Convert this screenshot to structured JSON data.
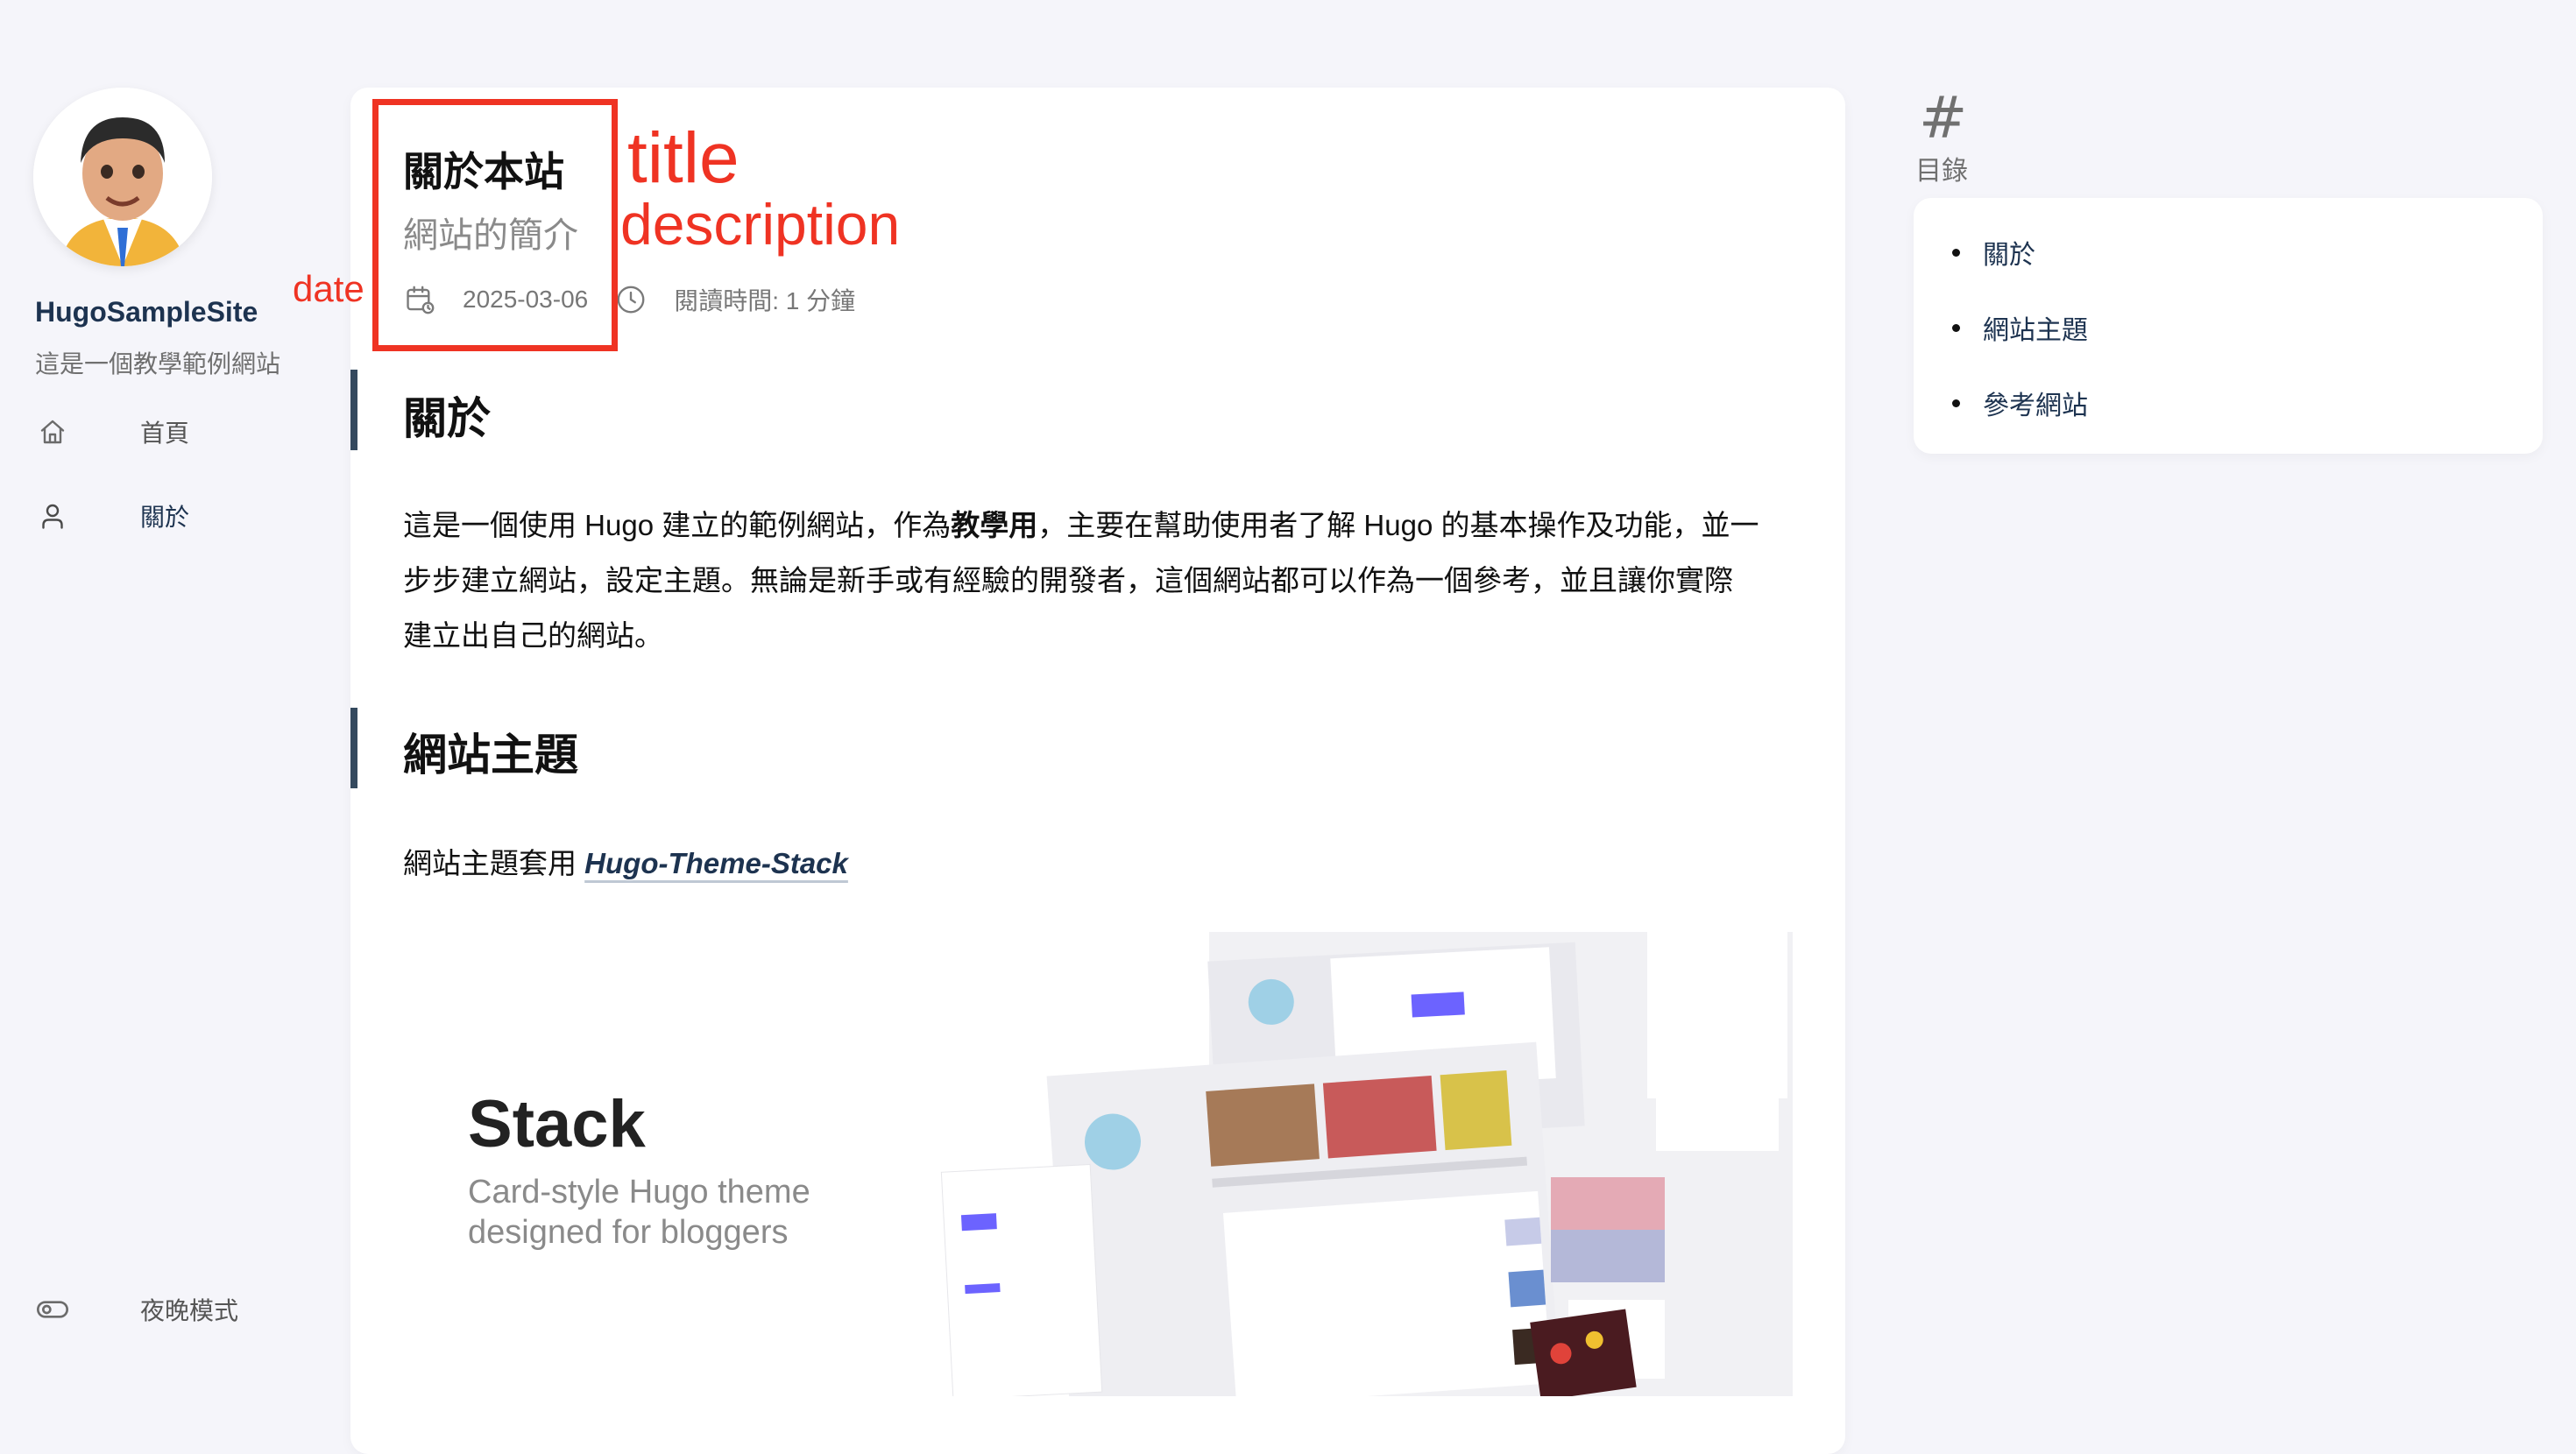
{
  "sidebar": {
    "site_name": "HugoSampleSite",
    "site_description": "這是一個教學範例網站",
    "menu": [
      {
        "label": "首頁",
        "icon": "home-icon"
      },
      {
        "label": "關於",
        "icon": "user-icon"
      }
    ],
    "dark_mode_label": "夜晚模式"
  },
  "article": {
    "title": "關於本站",
    "description": "網站的簡介",
    "date": "2025-03-06",
    "reading_time": "閱讀時間: 1 分鐘",
    "sections": [
      {
        "heading": "關於"
      },
      {
        "heading": "網站主題"
      }
    ],
    "about_text_1": "這是一個使用 Hugo 建立的範例網站，作為",
    "about_bold": "教學用",
    "about_text_2": "，主要在幫助使用者了解 Hugo 的基本操作及功能，並一",
    "about_line_2": "步步建立網站，設定主題。無論是新手或有經驗的開發者，這個網站都可以作為一個參考，並且讓你實際",
    "about_line_3": "建立出自己的網站。",
    "theme_text": "網站主題套用 ",
    "theme_link": "Hugo-Theme-Stack"
  },
  "banner": {
    "title": "Stack",
    "subtitle_1": "Card-style Hugo theme",
    "subtitle_2": "designed for bloggers"
  },
  "annotations": {
    "title": "title",
    "description": "description",
    "date": "date",
    "color": "#ef3323"
  },
  "toc": {
    "hash": "#",
    "label": "目錄",
    "items": [
      "關於",
      "網站主題",
      "參考網站"
    ]
  },
  "colors": {
    "background": "#f5f5fa",
    "accent": "#1d3350",
    "heading_bar": "#34495e"
  }
}
